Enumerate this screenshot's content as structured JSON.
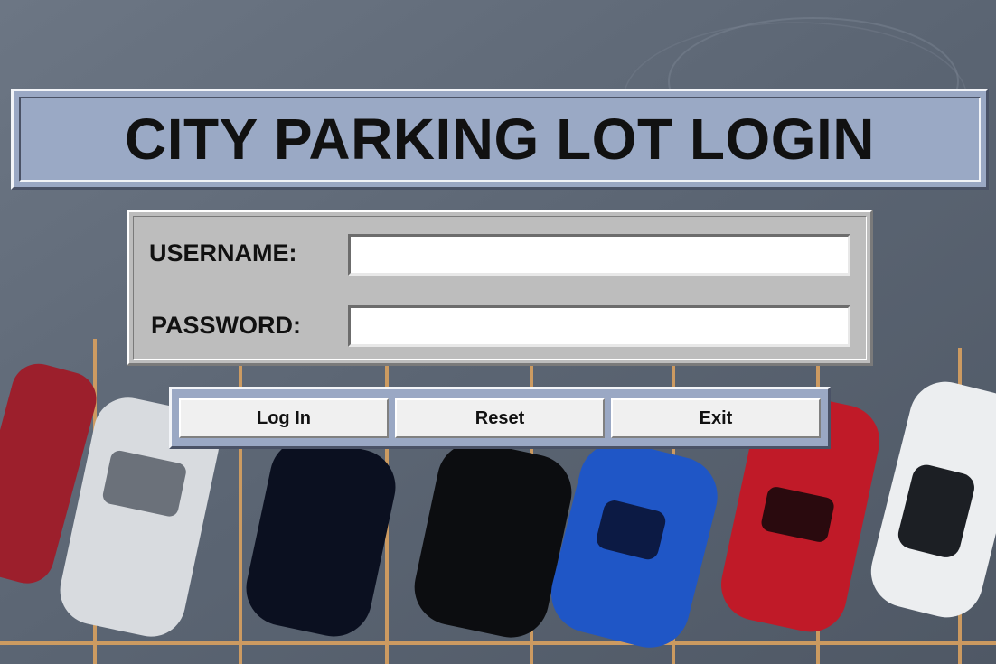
{
  "title": "CITY PARKING LOT LOGIN",
  "form": {
    "username_label": "USERNAME:",
    "username_value": "",
    "password_label": "PASSWORD:",
    "password_value": ""
  },
  "buttons": {
    "login": "Log In",
    "reset": "Reset",
    "exit": "Exit"
  },
  "colors": {
    "title_bg": "#9aa9c5",
    "form_bg": "#bdbdbd",
    "button_bg": "#f0f0f0",
    "lot_lines": "#e0a060"
  }
}
